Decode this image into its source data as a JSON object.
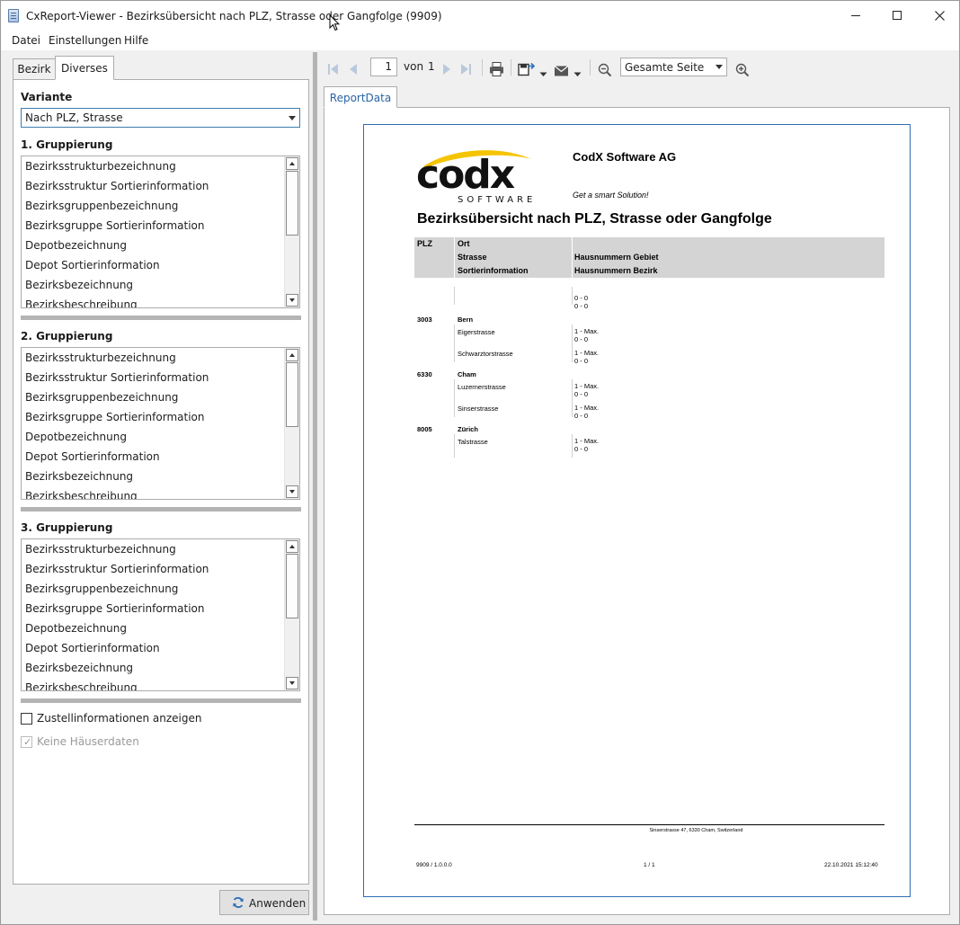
{
  "window": {
    "title": "CxReport-Viewer - Bezirksübersicht nach PLZ, Strasse oder Gangfolge (9909)"
  },
  "menu": {
    "datei": "Datei",
    "einstellungen": "Einstellungen",
    "hilfe": "Hilfe"
  },
  "left": {
    "tabs": [
      "Bezirk",
      "Diverses"
    ],
    "active_tab": "Diverses",
    "variante_label": "Variante",
    "variante_value": "Nach PLZ, Strasse",
    "groups": [
      {
        "label": "1. Gruppierung",
        "items": [
          "Bezirksstrukturbezeichnung",
          "Bezirksstruktur Sortierinformation",
          "Bezirksgruppenbezeichnung",
          "Bezirksgruppe Sortierinformation",
          "Depotbezeichnung",
          "Depot Sortierinformation",
          "Bezirksbezeichnung",
          "Bezirksbeschreibung"
        ]
      },
      {
        "label": "2. Gruppierung",
        "items": [
          "Bezirksstrukturbezeichnung",
          "Bezirksstruktur Sortierinformation",
          "Bezirksgruppenbezeichnung",
          "Bezirksgruppe Sortierinformation",
          "Depotbezeichnung",
          "Depot Sortierinformation",
          "Bezirksbezeichnung",
          "Bezirksbeschreibung"
        ]
      },
      {
        "label": "3. Gruppierung",
        "items": [
          "Bezirksstrukturbezeichnung",
          "Bezirksstruktur Sortierinformation",
          "Bezirksgruppenbezeichnung",
          "Bezirksgruppe Sortierinformation",
          "Depotbezeichnung",
          "Depot Sortierinformation",
          "Bezirksbezeichnung",
          "Bezirksbeschreibung"
        ]
      }
    ],
    "checkbox_zustell": "Zustellinformationen anzeigen",
    "checkbox_zustell_checked": false,
    "checkbox_haeuser": "Keine Häuserdaten",
    "checkbox_haeuser_checked": true,
    "apply_button": "Anwenden"
  },
  "toolbar": {
    "page_current": "1",
    "page_of": "von",
    "page_total": "1",
    "zoom_value": "Gesamte Seite"
  },
  "report": {
    "tab": "ReportData",
    "company": "CodX Software AG",
    "slogan": "Get a smart Solution!",
    "logo_text": "codx",
    "logo_sub": "SOFTWARE",
    "title": "Bezirksübersicht nach PLZ, Strasse oder Gangfolge",
    "headers": {
      "plz": "PLZ",
      "ort": "Ort",
      "strasse": "Strasse",
      "hn_gebiet": "Hausnummern Gebiet",
      "sortierinfo": "Sortierinformation",
      "hn_bezirk": "Hausnummern Bezirk"
    },
    "first_range_1": "0 - 0",
    "first_range_2": "0 - 0",
    "groups": [
      {
        "plz": "3003",
        "ort": "Bern",
        "streets": [
          {
            "name": "Eigerstrasse",
            "range1": "1 - Max.",
            "range2": "0 - 0"
          },
          {
            "name": "Schwarztorstrasse",
            "range1": "1 - Max.",
            "range2": "0 - 0"
          }
        ]
      },
      {
        "plz": "6330",
        "ort": "Cham",
        "streets": [
          {
            "name": "Luzernerstrasse",
            "range1": "1 - Max.",
            "range2": "0 - 0"
          },
          {
            "name": "Sinserstrasse",
            "range1": "1 - Max.",
            "range2": "0 - 0"
          }
        ]
      },
      {
        "plz": "8005",
        "ort": "Zürich",
        "streets": [
          {
            "name": "Talstrasse",
            "range1": "1 - Max.",
            "range2": "0 - 0"
          }
        ]
      }
    ],
    "footer_address": "Sinserstrasse 47, 6330 Cham, Switzerland",
    "footer_version": "9909 / 1.0.0.0",
    "footer_page": "1 / 1",
    "footer_date": "22.10.2021 15:12:40"
  },
  "colors": {
    "accent": "#2c6fb6",
    "header_band": "#d4d4d4",
    "logo_yellow": "#f5c400"
  }
}
